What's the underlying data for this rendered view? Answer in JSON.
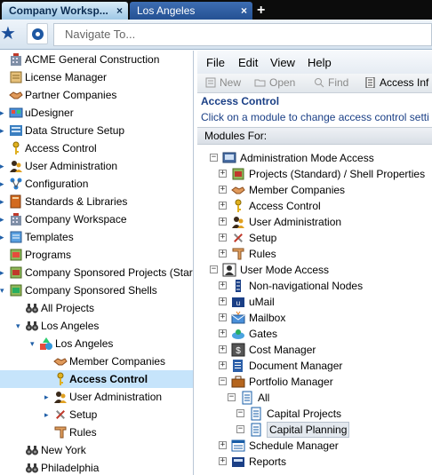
{
  "tabs": [
    {
      "label": "Company Worksp...",
      "close": "×"
    },
    {
      "label": "Los Angeles",
      "close": "×"
    }
  ],
  "new_tab": "+",
  "nav": {
    "placeholder": "Navigate To..."
  },
  "left_tree": [
    {
      "label": "ACME General Construction",
      "icon": "building-icon"
    },
    {
      "label": "License Manager",
      "icon": "license-icon"
    },
    {
      "label": "Partner Companies",
      "icon": "handshake-icon"
    },
    {
      "label": "uDesigner",
      "icon": "designer-icon"
    },
    {
      "label": "Data Structure Setup",
      "icon": "data-structure-icon"
    },
    {
      "label": "Access Control",
      "icon": "key-icon"
    },
    {
      "label": "User Administration",
      "icon": "users-icon"
    },
    {
      "label": "Configuration",
      "icon": "configuration-icon"
    },
    {
      "label": "Standards & Libraries",
      "icon": "library-icon"
    },
    {
      "label": "Company Workspace",
      "icon": "building-icon"
    },
    {
      "label": "Templates",
      "icon": "template-icon"
    },
    {
      "label": "Programs",
      "icon": "program-icon"
    },
    {
      "label": "Company Sponsored Projects (Star",
      "icon": "project-icon"
    },
    {
      "label": "Company Sponsored Shells",
      "icon": "shell-icon"
    },
    {
      "label": "All Projects",
      "icon": "binoculars-icon"
    },
    {
      "label": "Los Angeles",
      "icon": "binoculars-icon"
    },
    {
      "label": "Los Angeles",
      "icon": "shapes-icon"
    },
    {
      "label": "Member Companies",
      "icon": "handshake-icon"
    },
    {
      "label": "Access Control",
      "icon": "key-icon"
    },
    {
      "label": "User Administration",
      "icon": "users-icon"
    },
    {
      "label": "Setup",
      "icon": "tools-icon"
    },
    {
      "label": "Rules",
      "icon": "rules-icon"
    },
    {
      "label": "New York",
      "icon": "binoculars-icon"
    },
    {
      "label": "Philadelphia",
      "icon": "binoculars-icon"
    }
  ],
  "menu": [
    "File",
    "Edit",
    "View",
    "Help"
  ],
  "toolbar": [
    {
      "label": "New",
      "icon": "new-icon"
    },
    {
      "label": "Open",
      "icon": "open-icon"
    },
    {
      "label": "Find",
      "icon": "find-icon"
    },
    {
      "label": "Access Inf",
      "icon": "access-info-icon"
    }
  ],
  "panel": {
    "title": "Access Control",
    "description": "Click on a module to change access control setti",
    "modules_for": "Modules For:"
  },
  "modules": [
    {
      "label": "Administration Mode Access",
      "expander": "−"
    },
    {
      "label": "Projects (Standard) / Shell Properties",
      "expander": "+"
    },
    {
      "label": "Member Companies",
      "expander": "+"
    },
    {
      "label": "Access Control",
      "expander": "+"
    },
    {
      "label": "User Administration",
      "expander": "+"
    },
    {
      "label": "Setup",
      "expander": "+"
    },
    {
      "label": "Rules",
      "expander": "+"
    },
    {
      "label": "User Mode Access",
      "expander": "−"
    },
    {
      "label": "Non-navigational Nodes",
      "expander": "+"
    },
    {
      "label": "uMail",
      "expander": "+"
    },
    {
      "label": "Mailbox",
      "expander": "+"
    },
    {
      "label": "Gates",
      "expander": "+"
    },
    {
      "label": "Cost Manager",
      "expander": "+"
    },
    {
      "label": "Document Manager",
      "expander": "+"
    },
    {
      "label": "Portfolio Manager",
      "expander": "−"
    },
    {
      "label": "All",
      "expander": "−"
    },
    {
      "label": "Capital Projects",
      "expander": "−"
    },
    {
      "label": "Capital Planning",
      "expander": "−"
    },
    {
      "label": "Schedule Manager",
      "expander": "+"
    },
    {
      "label": "Reports",
      "expander": "+"
    }
  ],
  "colors": {
    "accent": "#1a3f86",
    "selection": "#c6e4fb",
    "tab_active": "#9fc8e6"
  }
}
